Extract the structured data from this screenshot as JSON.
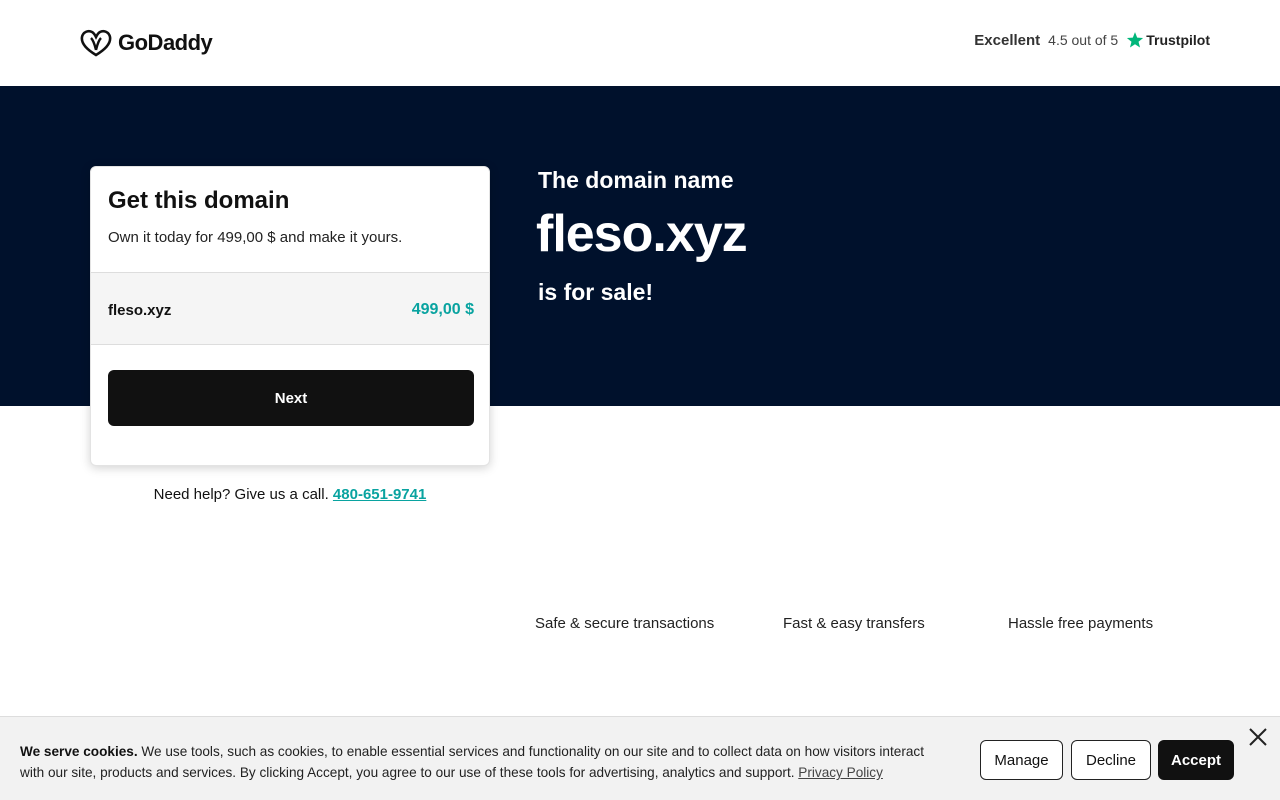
{
  "header": {
    "logo_text": "GoDaddy",
    "trust_label": "Excellent",
    "trust_score": "4.5 out of 5",
    "trust_brand": "Trustpilot"
  },
  "hero": {
    "line1": "The domain name",
    "domain": "fleso.xyz",
    "line2": "is for sale!"
  },
  "card": {
    "title": "Get this domain",
    "description": "Own it today for 499,00 $ and make it yours.",
    "row_domain": "fleso.xyz",
    "row_price": "499,00 $",
    "next_label": "Next"
  },
  "help": {
    "text": "Need help? Give us a call.",
    "phone": "480-651-9741"
  },
  "features": [
    "Safe & secure transactions",
    "Fast & easy transfers",
    "Hassle free payments"
  ],
  "cookie": {
    "bold": "We serve cookies.",
    "text": "We use tools, such as cookies, to enable essential services and functionality on our site and to collect data on how visitors interact with our site, products and services. By clicking Accept, you agree to our use of these tools for advertising, analytics and support.",
    "link": "Privacy Policy",
    "manage": "Manage",
    "decline": "Decline",
    "accept": "Accept"
  },
  "colors": {
    "hero_bg": "#00112c",
    "accent_teal": "#09a3a0",
    "trustpilot_green": "#00b67a"
  }
}
